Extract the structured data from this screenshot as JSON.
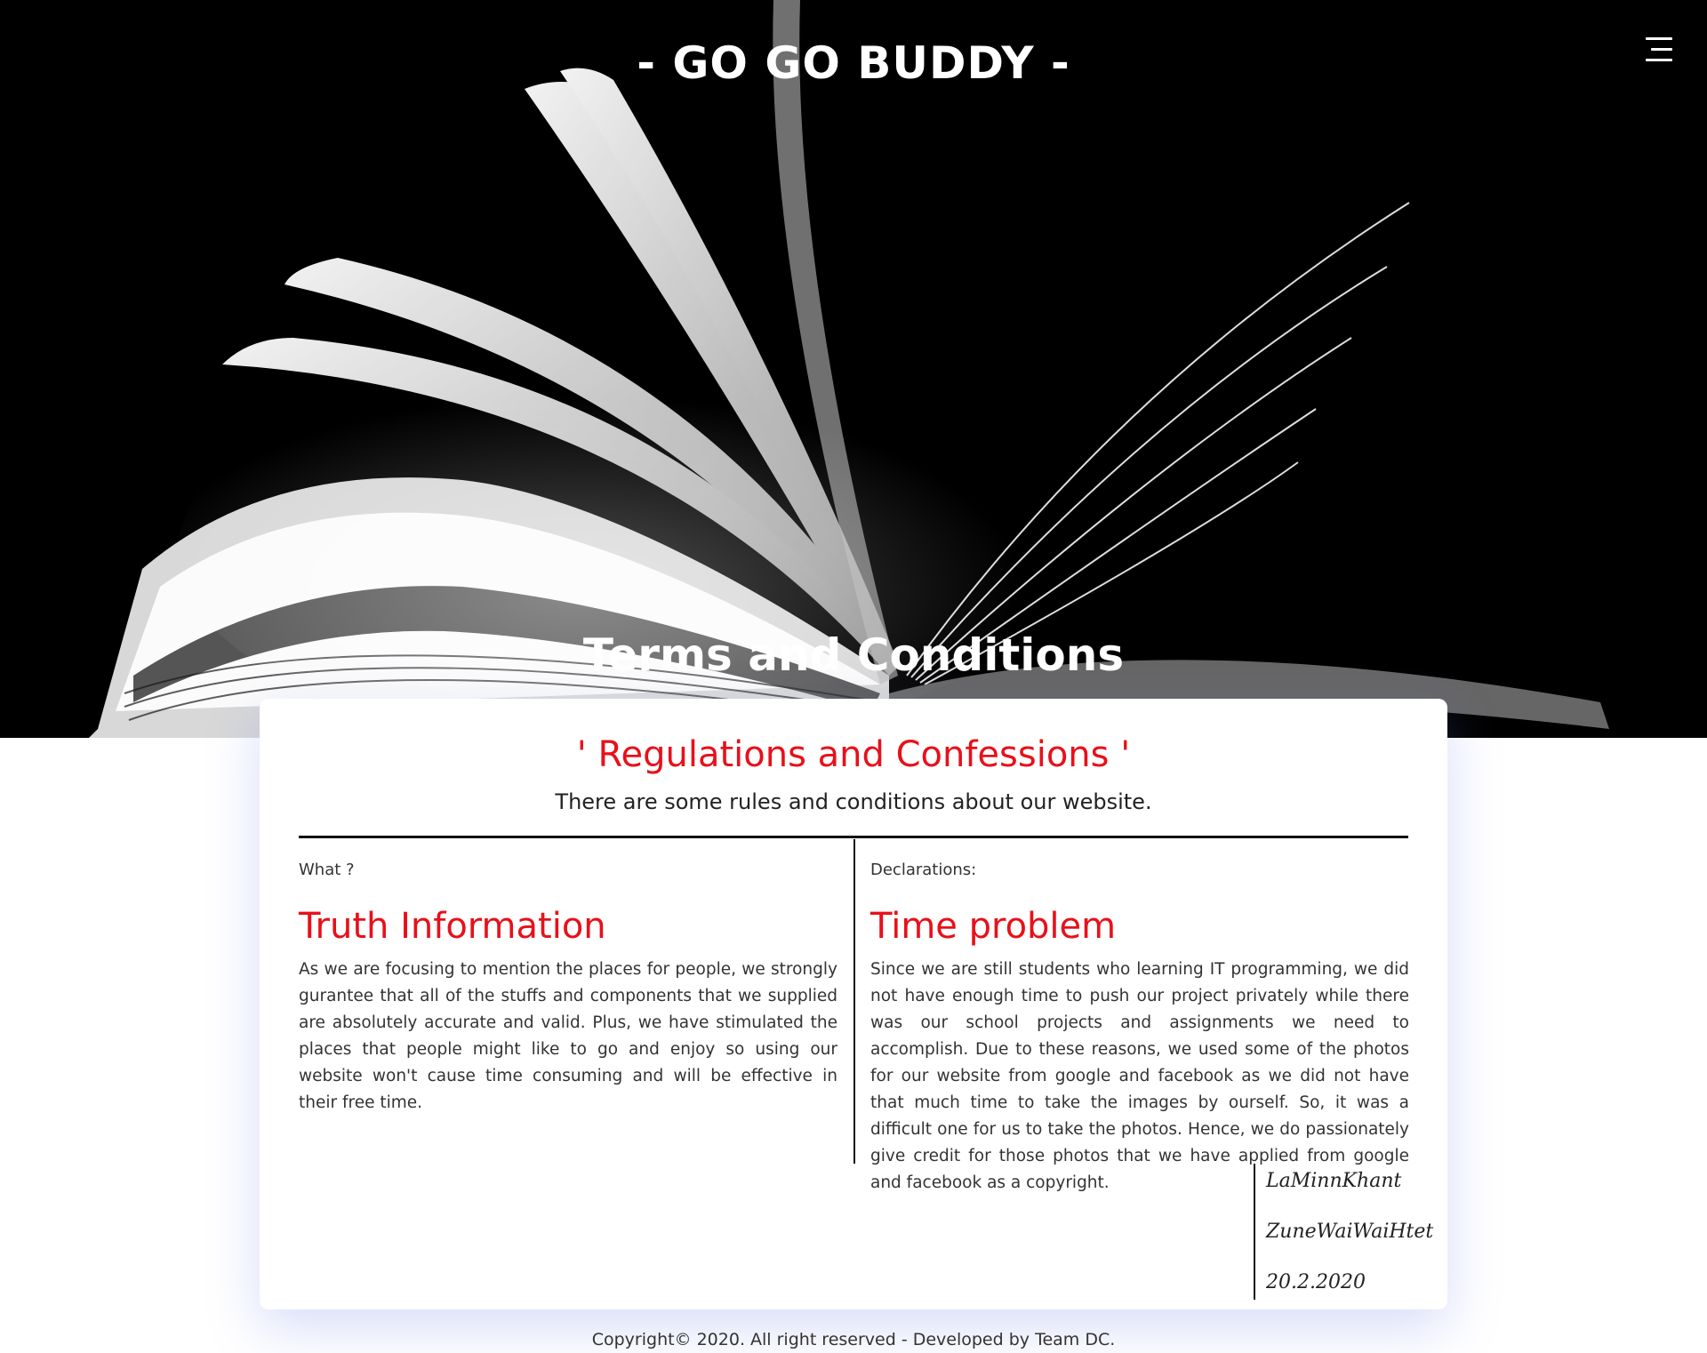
{
  "header": {
    "site_title": "- GO GO BUDDY -",
    "menu_icon": "hamburger-menu-icon"
  },
  "hero": {
    "image": "open-book-photo",
    "page_heading": "Terms and Conditions"
  },
  "card": {
    "title": "' Regulations and Confessions '",
    "subtitle": "There are some rules and conditions about our website.",
    "left": {
      "label": "What ?",
      "heading": "Truth Information",
      "text": "As we are focusing to mention the places for people, we strongly gurantee that all of the stuffs and components that we supplied are absolutely accurate and valid. Plus, we have stimulated the places that people might like to go and enjoy so using our website won't cause time consuming and will be effective in their free time."
    },
    "right": {
      "label": "Declarations:",
      "heading": "Time problem",
      "text": "Since we are still students who learning IT programming, we did not have enough time to push our project privately while there was our school projects and assignments we need to accomplish. Due to these reasons, we used some of the photos for our website from google and facebook as we did not have that much time to take the images by ourself. So, it was a difficult one for us to take the photos. Hence, we do passionately give credit for those photos that we have applied from google and facebook as a copyright."
    },
    "signatures": [
      "LaMinnKhant",
      "ZuneWaiWaiHtet",
      "20.2.2020"
    ]
  },
  "footer": {
    "text": "Copyright© 2020. All right reserved - Developed by Team DC."
  },
  "colors": {
    "accent_red": "#e8101a",
    "hero_background": "#000000",
    "card_shadow": "#6e82e6"
  }
}
